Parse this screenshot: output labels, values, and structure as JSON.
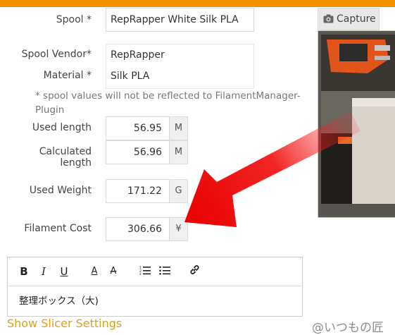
{
  "spool": {
    "label": "Spool *",
    "value": "RepRapper White Silk PLA",
    "vendor_label": "Spool Vendor*",
    "vendor_value": "RepRapper",
    "material_label": "Material *",
    "material_value": "Silk PLA",
    "note": "* spool values will not be reflected to FilamentManager-Plugin"
  },
  "measurements": {
    "used_length": {
      "label": "Used length",
      "value": "56.95",
      "unit": "M"
    },
    "calculated_length": {
      "label": "Calculated length",
      "value": "56.96",
      "unit": "M"
    },
    "used_weight": {
      "label": "Used Weight",
      "value": "171.22",
      "unit": "G"
    },
    "filament_cost": {
      "label": "Filament Cost",
      "value": "306.66",
      "unit": "¥"
    }
  },
  "camera": {
    "capture_label": "Capture",
    "icon": "camera-icon"
  },
  "editor": {
    "toolbar": {
      "bold": "B",
      "italic": "I",
      "underline": "U",
      "font_color": "A",
      "clear_format": "A"
    },
    "content": "整理ボックス（大)"
  },
  "links": {
    "show_slicer": "Show Slicer Settings"
  },
  "watermark": "@いつもの匠",
  "colors": {
    "accent": "#f39200",
    "link": "#d9a21b",
    "arrow": "#e60000"
  }
}
